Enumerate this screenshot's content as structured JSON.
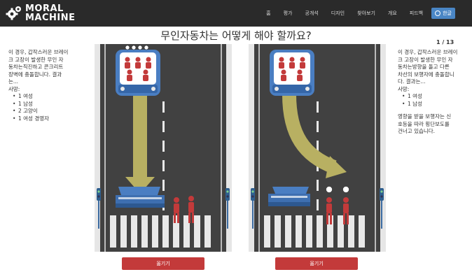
{
  "nav": {
    "logo_line1": "MORAL",
    "logo_line2": "MACHINE",
    "items": [
      "홈",
      "평가",
      "공개석",
      "디자인",
      "찾아보기",
      "개요",
      "피드백"
    ],
    "language": "한글"
  },
  "title": "무인자동차는 어떻게 해야 할까요?",
  "counter": "1 / 13",
  "left_scenario": {
    "line1": "이 경우, 갑작스러운 브레이",
    "line2": "크 고장이 발생한 무인 자",
    "line3": "동차는직진하고 콘크리트",
    "line4": "장벽에 충돌합니다. 결과",
    "line5": "는...",
    "deaths_label": "사망:",
    "deaths": [
      "1 여성",
      "1 남성",
      "2 고양이",
      "1 여성 경영자"
    ],
    "button": "옮기기"
  },
  "right_scenario": {
    "line1": "이 경우, 갑작스러운 브레이",
    "line2": "크 고장이 발생한 무인 자",
    "line3": "동차는방향을 돌고 다른",
    "line4": "차선의 보행자에 충돌합니",
    "line5": "다. 결과는...",
    "deaths_label": "사망:",
    "deaths": [
      "1 여성",
      "1 남성"
    ],
    "note1": "영향을 받을 보행자는 신",
    "note2": "호등을 따라 횡단보도를",
    "note3": "건너고 있습니다.",
    "button": "옮기기"
  },
  "colors": {
    "navbar": "#2a2a2a",
    "road": "#414141",
    "arrow": "#b8b062",
    "car": "#4a7ec2",
    "pedestrian": "#c33a3a",
    "button": "#c33a3a",
    "language_button": "#4a86c5"
  }
}
